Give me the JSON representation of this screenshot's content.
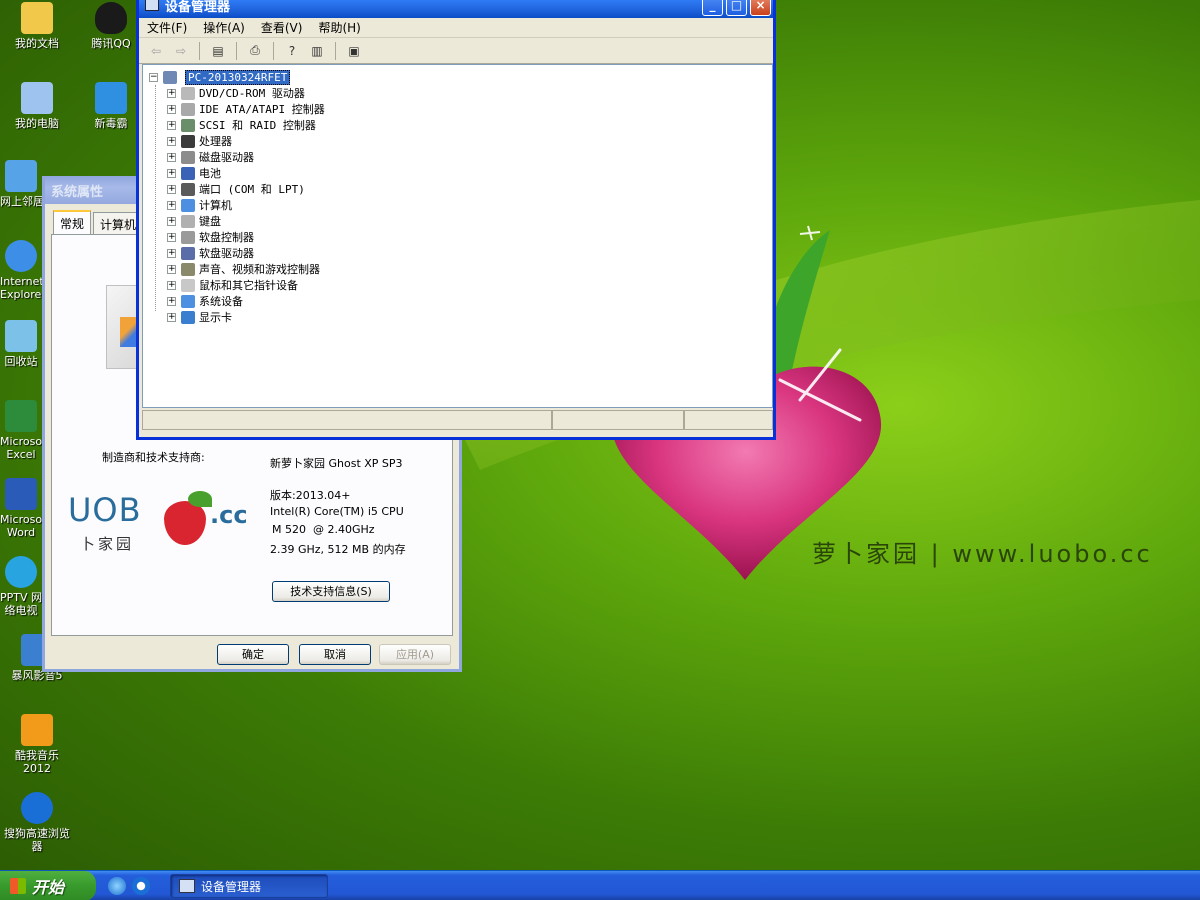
{
  "wallpaper": {
    "brand": "萝卜家园 | www.luobo.cc"
  },
  "desktop_icons": [
    {
      "label": "我的文档",
      "color": "#f2c84b"
    },
    {
      "label": "腾讯QQ",
      "color": "#1a1a1a"
    },
    {
      "label": "我的电脑",
      "color": "#9fc3ef"
    },
    {
      "label": "新毒霸",
      "color": "#2f8fe0"
    },
    {
      "label": "网上邻居",
      "color": "#56a3e8"
    },
    {
      "label": "Internet Explorer",
      "color": "#3d8ee6"
    },
    {
      "label": "回收站",
      "color": "#7cc1e8"
    },
    {
      "label": "Microsoft Excel",
      "color": "#2d8c3c"
    },
    {
      "label": "Microsoft Word",
      "color": "#2b5bb8"
    },
    {
      "label": "PPTV 网络电视",
      "color": "#28a4e0"
    },
    {
      "label": "暴风影音5",
      "color": "#3b7fd1"
    },
    {
      "label": "酷我音乐2012",
      "color": "#f29a1a"
    },
    {
      "label": "搜狗高速浏览器",
      "color": "#1a6fd6"
    }
  ],
  "device_manager": {
    "title": "设备管理器",
    "menu": [
      "文件(F)",
      "操作(A)",
      "查看(V)",
      "帮助(H)"
    ],
    "toolbar_icons": [
      "back-icon",
      "forward-icon",
      "properties-icon",
      "print-icon",
      "help-icon",
      "view-icon",
      "scan-hardware-icon"
    ],
    "root": "PC-20130324RFET",
    "devices": [
      {
        "label": "DVD/CD-ROM 驱动器",
        "color": "#b9b9b9"
      },
      {
        "label": "IDE ATA/ATAPI 控制器",
        "color": "#a9a9a9"
      },
      {
        "label": "SCSI 和 RAID 控制器",
        "color": "#6a8d6a"
      },
      {
        "label": "处理器",
        "color": "#3b3b3b"
      },
      {
        "label": "磁盘驱动器",
        "color": "#8c8c8c"
      },
      {
        "label": "电池",
        "color": "#3a62b5"
      },
      {
        "label": "端口 (COM 和 LPT)",
        "color": "#5a5a5a"
      },
      {
        "label": "计算机",
        "color": "#4d8fe0"
      },
      {
        "label": "键盘",
        "color": "#b0b0b0"
      },
      {
        "label": "软盘控制器",
        "color": "#9a9a9a"
      },
      {
        "label": "软盘驱动器",
        "color": "#5a6da8"
      },
      {
        "label": "声音、视频和游戏控制器",
        "color": "#8a8a6a"
      },
      {
        "label": "鼠标和其它指针设备",
        "color": "#c8c8c8"
      },
      {
        "label": "系统设备",
        "color": "#4d8fe0"
      },
      {
        "label": "显示卡",
        "color": "#3a7fcf"
      }
    ]
  },
  "system_properties": {
    "title": "系统属性",
    "tabs": [
      "常规",
      "计算机名"
    ],
    "manufacturer_label": "制造商和技术支持商:",
    "manufacturer": "新萝卜家园 Ghost XP SP3",
    "version": "版本:2013.04+",
    "cpu_line1": "Intel(R) Core(TM) i5 CPU",
    "cpu_line2": "M 520  @ 2.40GHz",
    "memory": "2.39 GHz, 512 MB 的内存",
    "support_button": "技术支持信息(S)",
    "ok_button": "确定",
    "cancel_button": "取消",
    "apply_button": "应用(A)",
    "logo_text_main": "UOB",
    "logo_text_sub": "卜家园",
    "logo_text_side": ".cc"
  },
  "taskbar": {
    "start_label": "开始",
    "quick_launch": [
      "ie-icon",
      "sogou-icon"
    ],
    "active_task": "设备管理器"
  }
}
